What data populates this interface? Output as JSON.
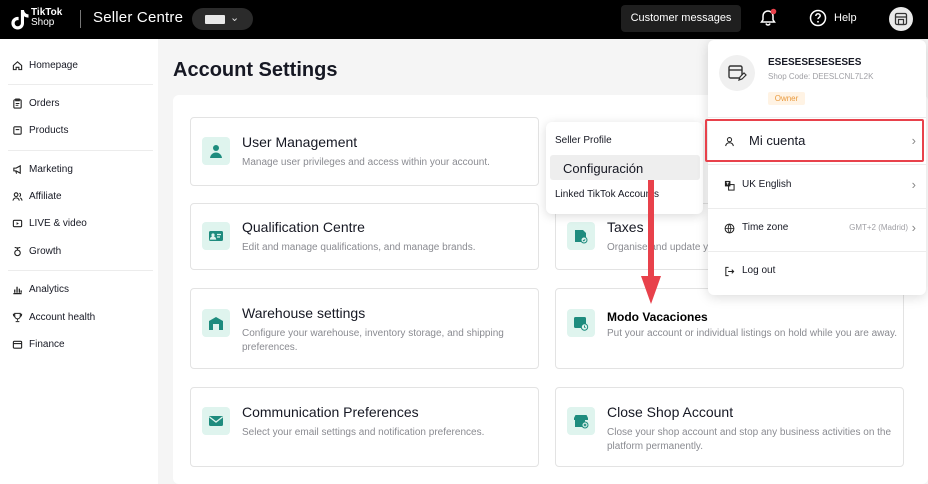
{
  "topbar": {
    "logo_line1": "TikTok",
    "logo_line2": "Shop",
    "brand": "Seller Centre",
    "customer_messages": "Customer messages",
    "help": "Help"
  },
  "sidebar": {
    "items": [
      {
        "label": "Homepage",
        "icon": "home-icon"
      },
      {
        "label": "Orders",
        "icon": "clipboard-icon"
      },
      {
        "label": "Products",
        "icon": "box-icon"
      },
      {
        "label": "Marketing",
        "icon": "megaphone-icon"
      },
      {
        "label": "Affiliate",
        "icon": "people-icon"
      },
      {
        "label": "LIVE & video",
        "icon": "video-icon"
      },
      {
        "label": "Growth",
        "icon": "sprout-icon"
      },
      {
        "label": "Analytics",
        "icon": "bar-chart-icon"
      },
      {
        "label": "Account health",
        "icon": "trophy-icon"
      },
      {
        "label": "Finance",
        "icon": "wallet-icon"
      }
    ]
  },
  "main": {
    "title": "Account Settings",
    "cards": [
      {
        "title": "User Management",
        "desc": "Manage user privileges and access within your account."
      },
      {
        "title": "Qualification Centre",
        "desc": "Edit and manage qualifications, and manage brands."
      },
      {
        "title": "Taxes",
        "desc": "Organise and update y"
      },
      {
        "title": "Warehouse settings",
        "desc": "Configure your warehouse, inventory storage, and shipping preferences."
      },
      {
        "title": "",
        "desc": "Put your account or individual listings on hold while you are away."
      },
      {
        "title": "Communication Preferences",
        "desc": "Select your email settings and notification preferences."
      },
      {
        "title": "Close Shop Account",
        "desc": "Close your shop account and stop any business activities on the platform permanently."
      }
    ]
  },
  "settings_menu": {
    "items": [
      "Seller Profile",
      "Configuración",
      "Linked TikTok Accounts"
    ]
  },
  "account_menu": {
    "name": "ESESESESESESES",
    "shop_code": "Shop Code: DEESLCNL7L2K",
    "badge": "Owner",
    "my_account": "Mi cuenta",
    "language": "UK English",
    "timezone_label": "Time zone",
    "timezone_value": "GMT+2 (Madrid)",
    "logout": "Log out"
  },
  "annotation": {
    "text": "Modo Vacaciones",
    "arrow_color": "#e8414b"
  },
  "colors": {
    "accent": "#e8414b",
    "icon_bg": "#dff4ee",
    "icon_fg": "#1e8c7e"
  }
}
